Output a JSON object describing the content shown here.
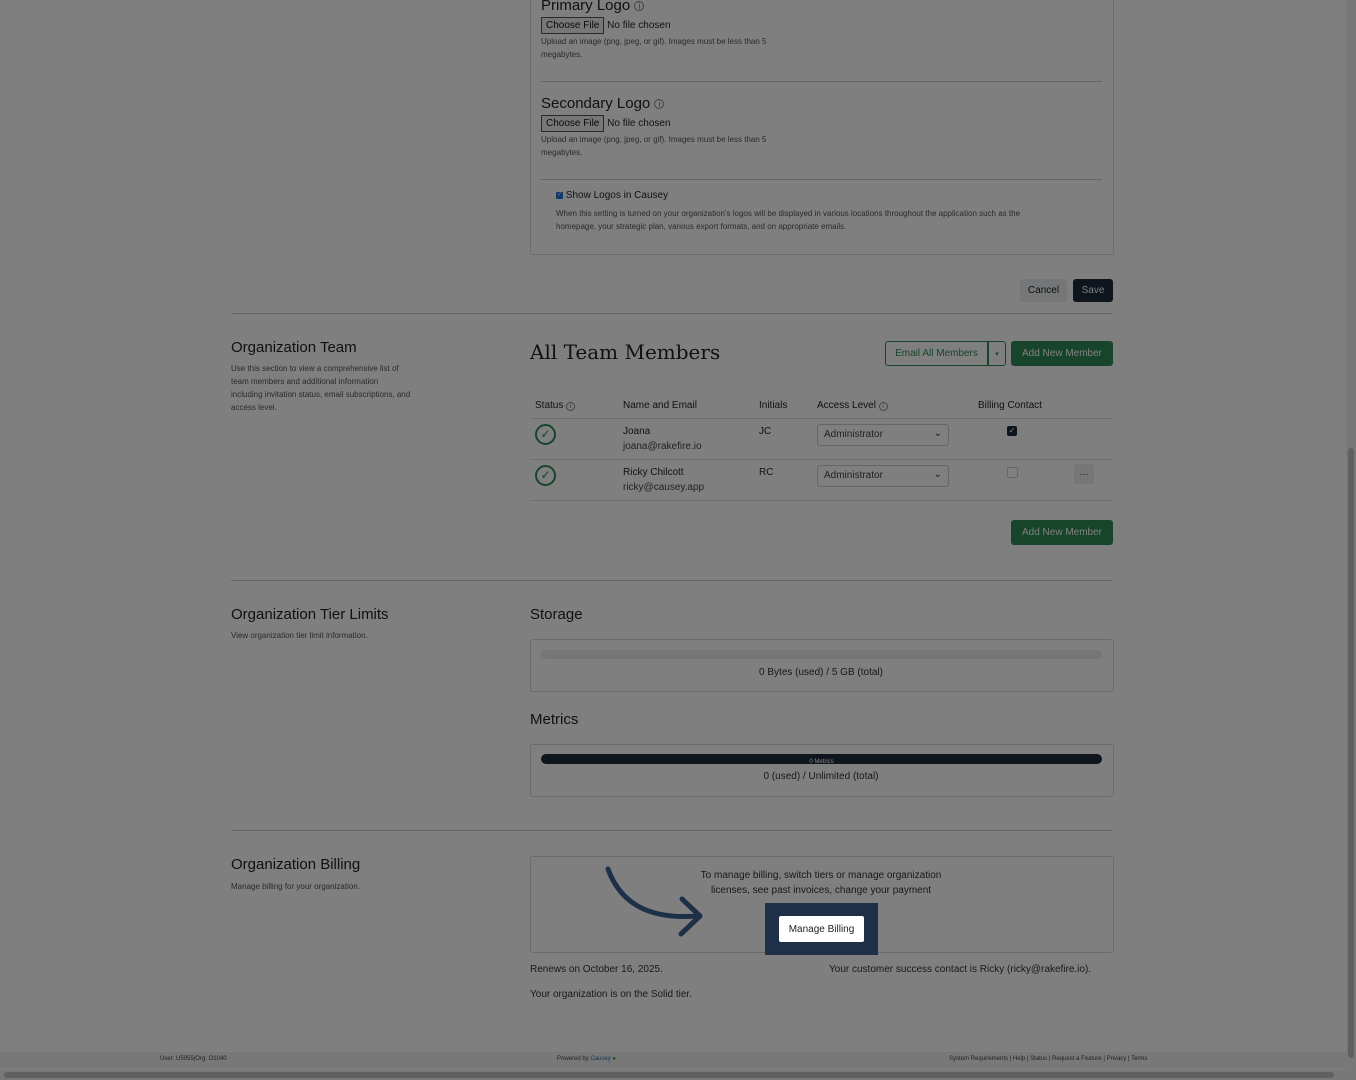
{
  "logos": {
    "primary_title": "Primary Logo",
    "secondary_title": "Secondary Logo",
    "choose_file": "Choose File",
    "no_file": "No file chosen",
    "help_line1": "Upload an image (png, jpeg, or gif). Images must be less than 5",
    "help_line2": "megabytes.",
    "show_logos_label": "Show Logos in Causey",
    "show_logos_checked": true,
    "show_logos_desc1": "When this setting is turned on your organization's logos will be displayed in various locations throughout the application such as the",
    "show_logos_desc2": "homepage, your strategic plan, various export formats, and on appropriate emails.",
    "cancel": "Cancel",
    "save": "Save"
  },
  "team": {
    "section_title": "Organization Team",
    "section_desc": [
      "Use this section to view a comprehensive list of",
      "team members and additional information",
      "including invitation status, email subscriptions, and",
      "access level."
    ],
    "heading": "All Team Members",
    "email_all": "Email All Members",
    "add_new": "Add New Member",
    "columns": [
      "Status",
      "Name and Email",
      "Initials",
      "Access Level",
      "Billing Contact"
    ],
    "members": [
      {
        "name": "Joana",
        "email": "joana@rakefire.io",
        "initials": "JC",
        "access": "Administrator",
        "billing": true
      },
      {
        "name": "Ricky Chilcott",
        "email": "ricky@causey.app",
        "initials": "RC",
        "access": "Administrator",
        "billing": false
      }
    ],
    "more": "···"
  },
  "tier": {
    "section_title": "Organization Tier Limits",
    "section_desc": "View organization tier limit information.",
    "storage_title": "Storage",
    "storage_text": "0 Bytes (used) / 5 GB (total)",
    "storage_used_fraction": 0,
    "metrics_title": "Metrics",
    "metrics_bar_label": "0 Metrics",
    "metrics_text": "0 (used) / Unlimited (total)"
  },
  "billing": {
    "section_title": "Organization Billing",
    "section_desc": "Manage billing for your organization.",
    "info_line1": "To manage billing, switch tiers or manage organization",
    "info_line2": "licenses, see past invoices, change your payment",
    "manage_button": "Manage Billing",
    "renews": "Renews on October 16, 2025.",
    "contact": "Your customer success contact is Ricky (ricky@rakefire.io).",
    "tier_text": "Your organization is on the Solid tier."
  },
  "footer": {
    "user": "User: U5955|Org: O1040",
    "powered": "Powered by",
    "brand": "Causey",
    "links": "System Requirements | Help | Status | Request a Feature | Privacy | Terms"
  },
  "colors": {
    "green": "#2e8b57",
    "navy": "#1e2a3a",
    "spotlight": "#1e3048"
  }
}
